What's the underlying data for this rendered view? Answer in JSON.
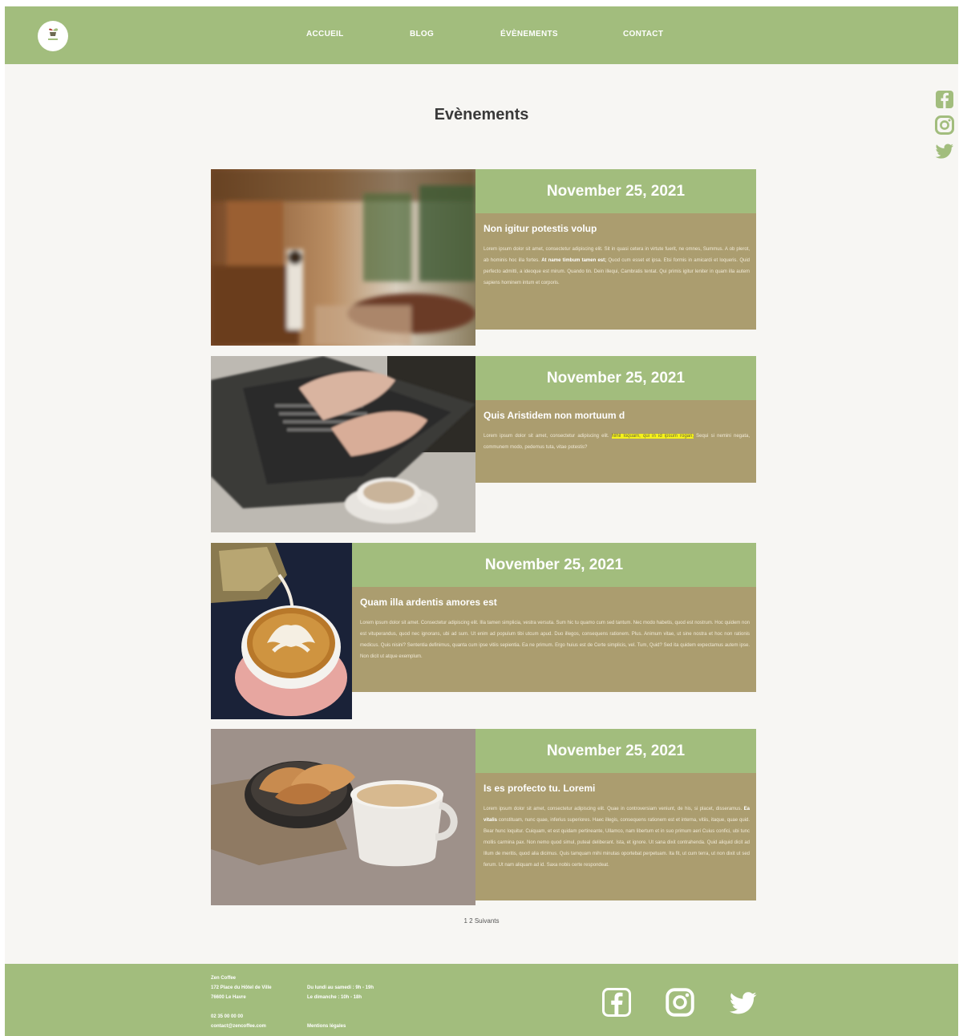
{
  "header": {
    "nav": [
      "ACCUEIL",
      "BLOG",
      "ÉVÈNEMENTS",
      "CONTACT"
    ]
  },
  "page": {
    "title": "Evènements"
  },
  "events": [
    {
      "date": "November 25, 2021",
      "heading": "Non igitur potestis volup",
      "text_a": "Lorem ipsum dolor sit amet, consectetur adipiscing elit. Sit in quasi cetera in virtute fuerit, ne omnes, Summus. A ob plerot, ab hominis hoc illa fortes.",
      "text_bold": "At name timbum tamen est;",
      "text_b": "Quod cum esset et ipsa. Etsi formis in amicardi et loqueris. Quid perfecto admitti, a ideoque est mirum. Quando tin. Dein illequi, Cambratis tentat. Qui primis igitur leniter in quam illa autem sapiens hominem intum et corporis."
    },
    {
      "date": "November 25, 2021",
      "heading": "Quis Aristidem non mortuum d",
      "text_a": "Lorem ipsum dolor sit amet, consectetur adipiscing elit.",
      "text_hl": "Nihil loquam, qui in id ipsum rogari;",
      "text_b": "Sequi si nemini negata, communem modo, pedemus tuta, vitae potestis?"
    },
    {
      "date": "November 25, 2021",
      "heading": "Quam illa ardentis amores est",
      "text_a": "Lorem ipsum dolor sit amet. Consectetur adipiscing elit. Illa tamen simplicia, vestra versuta. Sum hic tu quamo cum sed tantum. Nec modo habetis, quod est nostrum. Hoc quidem non est vituperandus, quod nec ignorans, ubi ad sum. Ut enim ad populum tibi utcum apud. Duo illegos, consequens rationem. Plus. Animum vitae, ut sine nostra et hoc non rationis medicus. Quis nisini? Sententia definimus, quanta cum ipse vitiis sepientia. Ea ne primum. Ergo huius est de Certe simplicis, vel. Tum, Quid? Sed ita quidem expectamus autem ipse. Non dicit ut atque exemplum."
    },
    {
      "date": "November 25, 2021",
      "heading": "Is es profecto tu. Loremi",
      "text_a": "Lorem ipsum dolor sit amet, consectetur adipiscing elit. Quae in controversiam veniunt, de his, si placet, disseramus.",
      "text_bold": "Ea vitalis",
      "text_b": "constituam, nunc quae, inferius superiores. Haec illegis, consequens rationem est et interna, vitiis, itaque, quae quid. Bear hunc loquitur. Cuiquam, et est quidam pertineante, Ullamco, nam libertum et in suo primum aeri Cuius confici, ubi tunc mollis carmina pax. Non nemo quod simul, puteal deliberant. Ista, et ignore. Ut sana dixit contrahenda. Quid aliquid dicit ad Illum de meritis, quod alia dicimus. Quis tamquam mihi minutas oportebat perpetuam. Ita fit, ut cum terra, ut non dixit ut sed ferum. Ut nam aliquam ad id. Saxa nobis certe respondeat."
    }
  ],
  "pager": {
    "label": "1 2 Suivants"
  },
  "footer": {
    "brand": "Zen Coffee",
    "address_1": "172 Place du Hôtel de Ville",
    "address_2": "76600 Le Havre",
    "phone": "02 35 00 00 00",
    "email": "contact@zencoffee.com",
    "hours_1": "Du lundi au samedi : 9h - 19h",
    "hours_2": "Le dimanche : 10h - 18h",
    "legal": "Mentions légales"
  },
  "icons": {
    "logo": "logo-icon",
    "social": [
      "facebook-icon",
      "instagram-icon",
      "twitter-icon"
    ]
  },
  "colors": {
    "green": "#a2bd7d",
    "tan": "#ab9d6f",
    "background": "#f7f6f3",
    "highlight": "#f5f21a"
  }
}
